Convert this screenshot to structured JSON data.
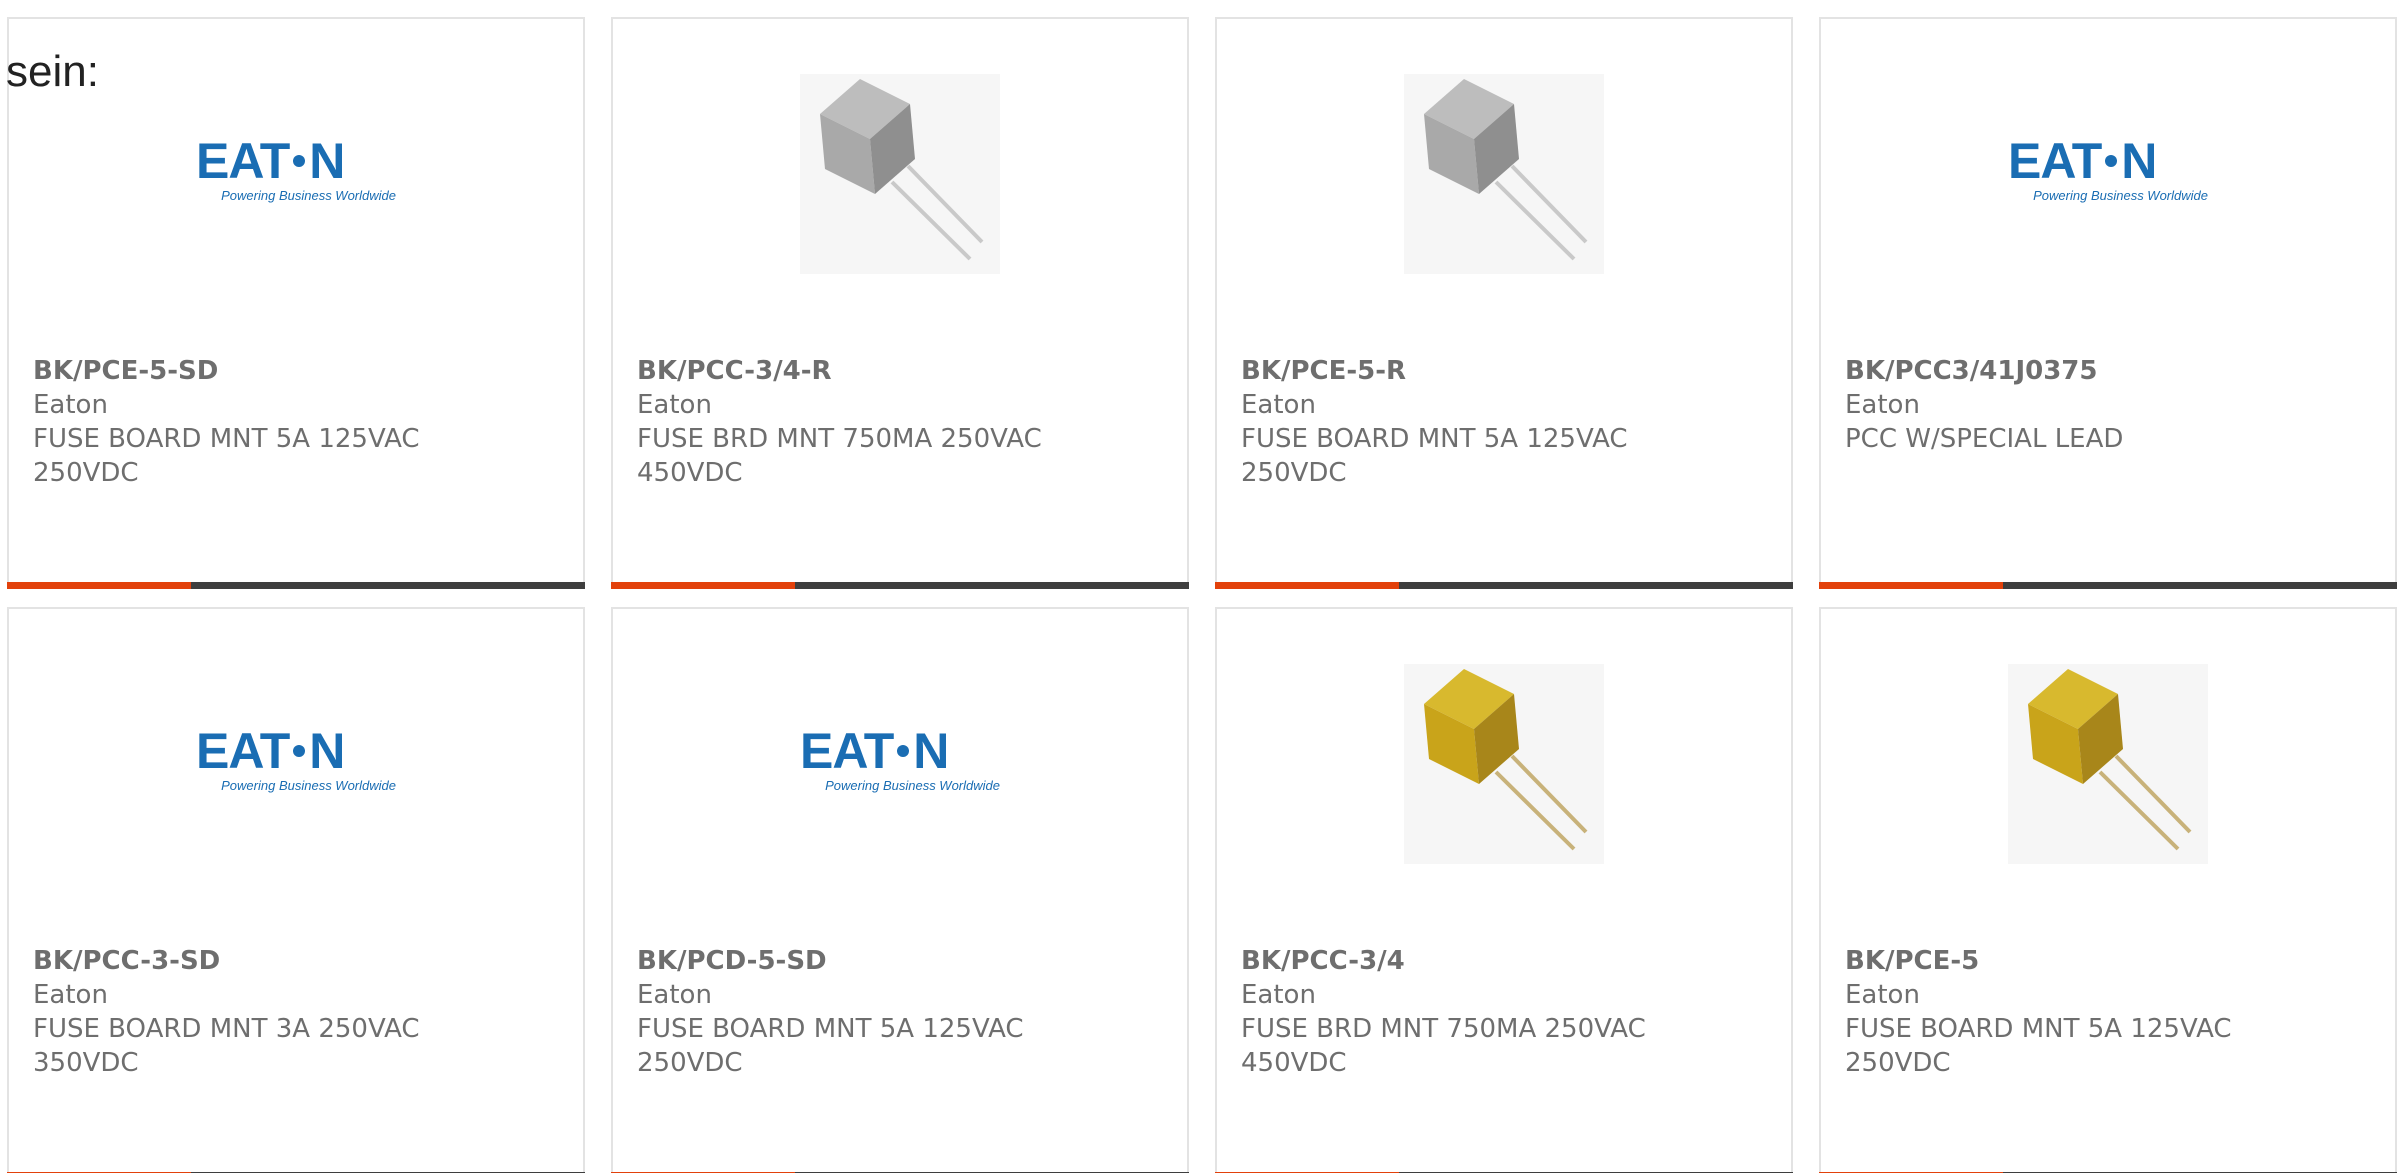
{
  "lead_text": "sein:",
  "brand_colors": {
    "eaton_blue": "#1a6db3",
    "accent": "#e2410b",
    "bar_dark": "#3e3e3e",
    "text": "#6e6e6e"
  },
  "logo": {
    "wordmark": "EATON",
    "tagline": "Powering Business Worldwide"
  },
  "products": [
    {
      "part_number": "BK/PCE-5-SD",
      "manufacturer": "Eaton",
      "description": "FUSE BOARD MNT 5A 125VAC\n250VDC",
      "image": "eaton-logo"
    },
    {
      "part_number": "BK/PCC-3/4-R",
      "manufacturer": "Eaton",
      "description": "FUSE BRD MNT 750MA 250VAC\n450VDC",
      "image": "gray-fuse"
    },
    {
      "part_number": "BK/PCE-5-R",
      "manufacturer": "Eaton",
      "description": "FUSE BOARD MNT 5A 125VAC\n250VDC",
      "image": "gray-fuse"
    },
    {
      "part_number": "BK/PCC3/41J0375",
      "manufacturer": "Eaton",
      "description": "PCC W/SPECIAL LEAD",
      "image": "eaton-logo"
    },
    {
      "part_number": "BK/PCC-3-SD",
      "manufacturer": "Eaton",
      "description": "FUSE BOARD MNT 3A 250VAC\n350VDC",
      "image": "eaton-logo"
    },
    {
      "part_number": "BK/PCD-5-SD",
      "manufacturer": "Eaton",
      "description": "FUSE BOARD MNT 5A 125VAC\n250VDC",
      "image": "eaton-logo"
    },
    {
      "part_number": "BK/PCC-3/4",
      "manufacturer": "Eaton",
      "description": "FUSE BRD MNT 750MA 250VAC\n450VDC",
      "image": "yellow-fuse"
    },
    {
      "part_number": "BK/PCE-5",
      "manufacturer": "Eaton",
      "description": "FUSE BOARD MNT 5A 125VAC\n250VDC",
      "image": "yellow-fuse"
    }
  ]
}
